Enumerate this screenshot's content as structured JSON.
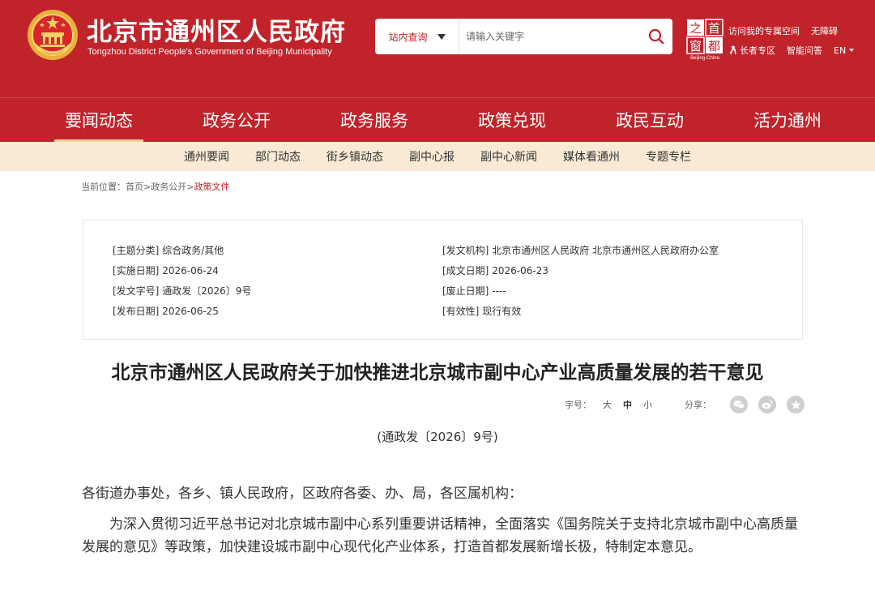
{
  "header": {
    "site_name_cn": "北京市通州区人民政府",
    "site_name_en": "Tongzhou District People's Government of Beijing Municipality",
    "search": {
      "scope_label": "站内查询",
      "placeholder": "请输入关键字"
    },
    "capital_logo_chars": [
      "之",
      "首",
      "窗",
      "都"
    ],
    "capital_logo_caption": "Beijing-China",
    "links_row1": [
      "访问我的专属空间",
      "无障碍"
    ],
    "links_row2": {
      "elder": "长者专区",
      "qa": "智能问答",
      "lang": "EN"
    }
  },
  "nav": {
    "items": [
      "要闻动态",
      "政务公开",
      "政务服务",
      "政策兑现",
      "政民互动",
      "活力通州"
    ],
    "active_index": 0
  },
  "subnav": {
    "items": [
      "通州要闻",
      "部门动态",
      "街乡镇动态",
      "副中心报",
      "副中心新闻",
      "媒体看通州",
      "专题专栏"
    ]
  },
  "breadcrumb": {
    "prefix": "当前位置：",
    "items": [
      "首页",
      "政务公开",
      "政策文件"
    ],
    "separator": ">"
  },
  "info": {
    "left": [
      {
        "k": "[主题分类]",
        "v": "综合政务/其他"
      },
      {
        "k": "[实施日期]",
        "v": "2026-06-24"
      },
      {
        "k": "[发文字号]",
        "v": "通政发〔2026〕9号"
      },
      {
        "k": "[发布日期]",
        "v": "2026-06-25"
      }
    ],
    "right": [
      {
        "k": "[发文机构]",
        "v": "北京市通州区人民政府 北京市通州区人民政府办公室"
      },
      {
        "k": "[成文日期]",
        "v": "2026-06-23"
      },
      {
        "k": "[废止日期]",
        "v": "----"
      },
      {
        "k": "[有效性]",
        "v": "现行有效"
      }
    ]
  },
  "article": {
    "title": "北京市通州区人民政府关于加快推进北京城市副中心产业高质量发展的若干意见",
    "font_size_label": "字号：",
    "font_sizes": [
      "大",
      "中",
      "小"
    ],
    "font_size_active": "中",
    "share_label": "分享：",
    "share_icons": [
      "wechat-icon",
      "weibo-icon",
      "favorite-icon"
    ],
    "doc_number": "(通政发〔2026〕9号)",
    "paragraphs": [
      "各街道办事处，各乡、镇人民政府，区政府各委、办、局，各区属机构：",
      "为深入贯彻习近平总书记对北京城市副中心系列重要讲话精神，全面落实《国务院关于支持北京城市副中心高质量发展的意见》等政策，加快建设城市副中心现代化产业体系，打造首都发展新增长极，特制定本意见。"
    ]
  },
  "colors": {
    "brand_red": "#c1232b",
    "subnav_bg": "#f8ead5",
    "active_underline": "#f6d29c"
  }
}
